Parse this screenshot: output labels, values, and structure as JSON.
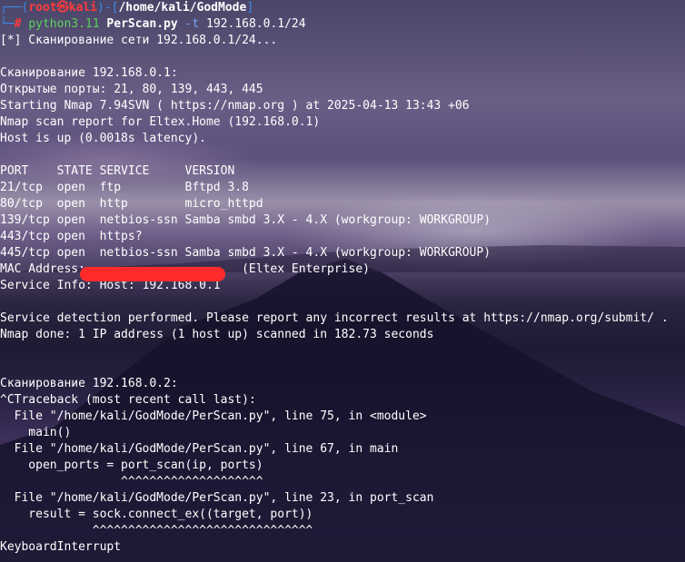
{
  "prompt": {
    "line1": {
      "frame_open": "┌──(",
      "user": "root",
      "at": "㉿",
      "host": "kali",
      "frame_mid": ")-[",
      "path": "/home/kali/GodMode",
      "frame_close": "]"
    },
    "line2": {
      "corner": "└─",
      "hash": "# ",
      "cmd": "python3.11",
      "space1": " ",
      "script": "PerScan.py",
      "space2": " ",
      "opt": "-t",
      "space3": " ",
      "arg": "192.168.0.1/24"
    }
  },
  "output": [
    "[*] Сканирование сети 192.168.0.1/24...",
    "",
    "Сканирование 192.168.0.1:",
    "Открытые порты: 21, 80, 139, 443, 445",
    "Starting Nmap 7.94SVN ( https://nmap.org ) at 2025-04-13 13:43 +06",
    "Nmap scan report for Eltex.Home (192.168.0.1)",
    "Host is up (0.0018s latency).",
    "",
    "PORT    STATE SERVICE     VERSION",
    "21/tcp  open  ftp         Bftpd 3.8",
    "80/tcp  open  http        micro_httpd",
    "139/tcp open  netbios-ssn Samba smbd 3.X - 4.X (workgroup: WORKGROUP)",
    "443/tcp open  https?",
    "445/tcp open  netbios-ssn Samba smbd 3.X - 4.X (workgroup: WORKGROUP)",
    "MAC Address:                      (Eltex Enterprise)",
    "Service Info: Host: 192.168.0.1",
    "",
    "Service detection performed. Please report any incorrect results at https://nmap.org/submit/ .",
    "Nmap done: 1 IP address (1 host up) scanned in 182.73 seconds",
    "",
    "",
    "Сканирование 192.168.0.2:",
    "^CTraceback (most recent call last):",
    "  File \"/home/kali/GodMode/PerScan.py\", line 75, in <module>",
    "    main()",
    "  File \"/home/kali/GodMode/PerScan.py\", line 67, in main",
    "    open_ports = port_scan(ip, ports)",
    "                 ^^^^^^^^^^^^^^^^^^^^",
    "  File \"/home/kali/GodMode/PerScan.py\", line 23, in port_scan",
    "    result = sock.connect_ex((target, port))",
    "             ^^^^^^^^^^^^^^^^^^^^^^^^^^^^^^^",
    "KeyboardInterrupt"
  ],
  "colors": {
    "prompt_frame": "#3b8eea",
    "prompt_user": "#ff3b3b",
    "command": "#5ad25a",
    "redaction": "#ff2a2a"
  }
}
